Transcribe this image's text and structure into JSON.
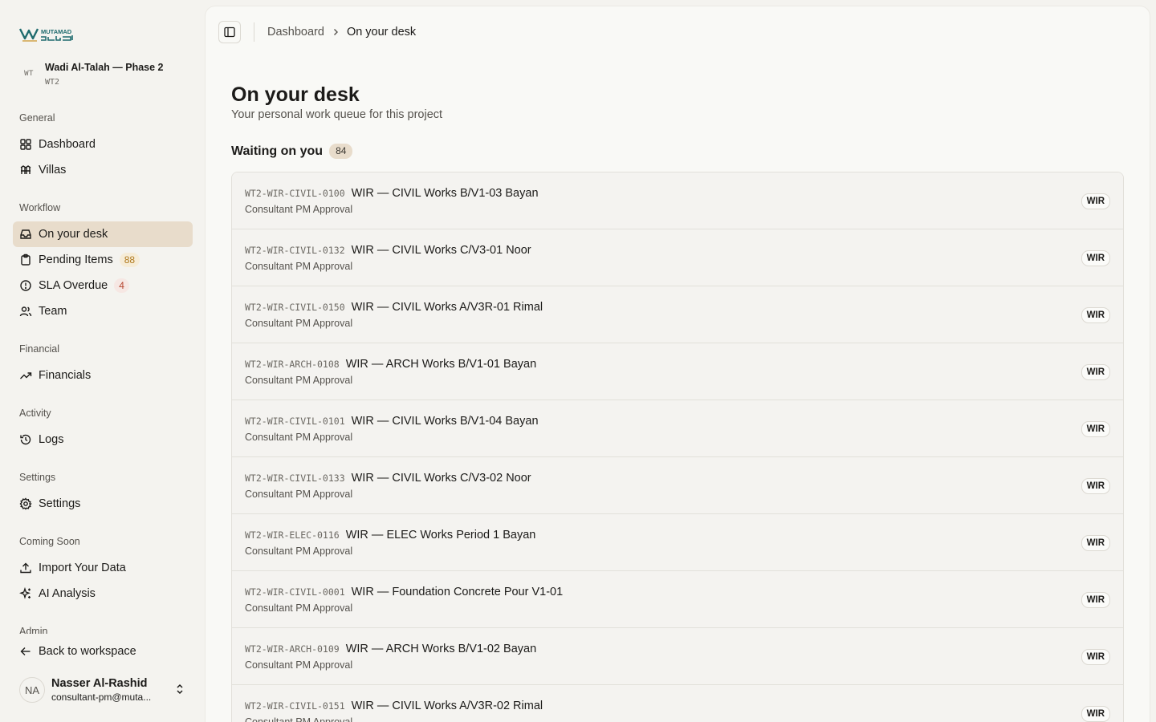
{
  "brand": {
    "name": "MUTAMAD",
    "name_ar": "معتمد",
    "accent": "#1f6b6e"
  },
  "project": {
    "badge": "WT",
    "name": "Wadi Al-Talah — Phase 2",
    "code": "WT2"
  },
  "sidebar": {
    "sections": {
      "general": "General",
      "workflow": "Workflow",
      "financial": "Financial",
      "activity": "Activity",
      "settings": "Settings",
      "coming_soon": "Coming Soon",
      "admin": "Admin"
    },
    "items": {
      "dashboard": {
        "label": "Dashboard",
        "icon": "grid-icon"
      },
      "villas": {
        "label": "Villas",
        "icon": "villas-icon"
      },
      "on_your_desk": {
        "label": "On your desk",
        "icon": "inbox-icon",
        "active": true
      },
      "pending_items": {
        "label": "Pending Items",
        "icon": "clipboard-icon",
        "count": "88"
      },
      "sla_overdue": {
        "label": "SLA Overdue",
        "icon": "alert-circle-icon",
        "count": "4"
      },
      "team": {
        "label": "Team",
        "icon": "users-icon"
      },
      "financials": {
        "label": "Financials",
        "icon": "trending-up-icon"
      },
      "logs": {
        "label": "Logs",
        "icon": "history-icon"
      },
      "settings": {
        "label": "Settings",
        "icon": "gear-icon"
      },
      "import_data": {
        "label": "Import Your Data",
        "icon": "upload-icon"
      },
      "ai_analysis": {
        "label": "AI Analysis",
        "icon": "sparkles-icon"
      },
      "back": {
        "label": "Back to workspace",
        "icon": "arrow-left-icon"
      }
    }
  },
  "user": {
    "initials": "NA",
    "name": "Nasser Al-Rashid",
    "email": "consultant-pm@muta..."
  },
  "breadcrumb": {
    "root": "Dashboard",
    "current": "On your desk"
  },
  "page": {
    "title": "On your desk",
    "subtitle": "Your personal work queue for this project",
    "waiting_label": "Waiting on you",
    "waiting_count": "84"
  },
  "queue": [
    {
      "code": "WT2-WIR-CIVIL-0100",
      "title": "WIR — CIVIL Works B/V1-03 Bayan",
      "stage": "Consultant PM Approval",
      "tag": "WIR"
    },
    {
      "code": "WT2-WIR-CIVIL-0132",
      "title": "WIR — CIVIL Works C/V3-01 Noor",
      "stage": "Consultant PM Approval",
      "tag": "WIR"
    },
    {
      "code": "WT2-WIR-CIVIL-0150",
      "title": "WIR — CIVIL Works A/V3R-01 Rimal",
      "stage": "Consultant PM Approval",
      "tag": "WIR"
    },
    {
      "code": "WT2-WIR-ARCH-0108",
      "title": "WIR — ARCH Works B/V1-01 Bayan",
      "stage": "Consultant PM Approval",
      "tag": "WIR"
    },
    {
      "code": "WT2-WIR-CIVIL-0101",
      "title": "WIR — CIVIL Works B/V1-04 Bayan",
      "stage": "Consultant PM Approval",
      "tag": "WIR"
    },
    {
      "code": "WT2-WIR-CIVIL-0133",
      "title": "WIR — CIVIL Works C/V3-02 Noor",
      "stage": "Consultant PM Approval",
      "tag": "WIR"
    },
    {
      "code": "WT2-WIR-ELEC-0116",
      "title": "WIR — ELEC Works Period 1 Bayan",
      "stage": "Consultant PM Approval",
      "tag": "WIR"
    },
    {
      "code": "WT2-WIR-CIVIL-0001",
      "title": "WIR — Foundation Concrete Pour V1-01",
      "stage": "Consultant PM Approval",
      "tag": "WIR"
    },
    {
      "code": "WT2-WIR-ARCH-0109",
      "title": "WIR — ARCH Works B/V1-02 Bayan",
      "stage": "Consultant PM Approval",
      "tag": "WIR"
    },
    {
      "code": "WT2-WIR-CIVIL-0151",
      "title": "WIR — CIVIL Works A/V3R-02 Rimal",
      "stage": "Consultant PM Approval",
      "tag": "WIR"
    }
  ]
}
